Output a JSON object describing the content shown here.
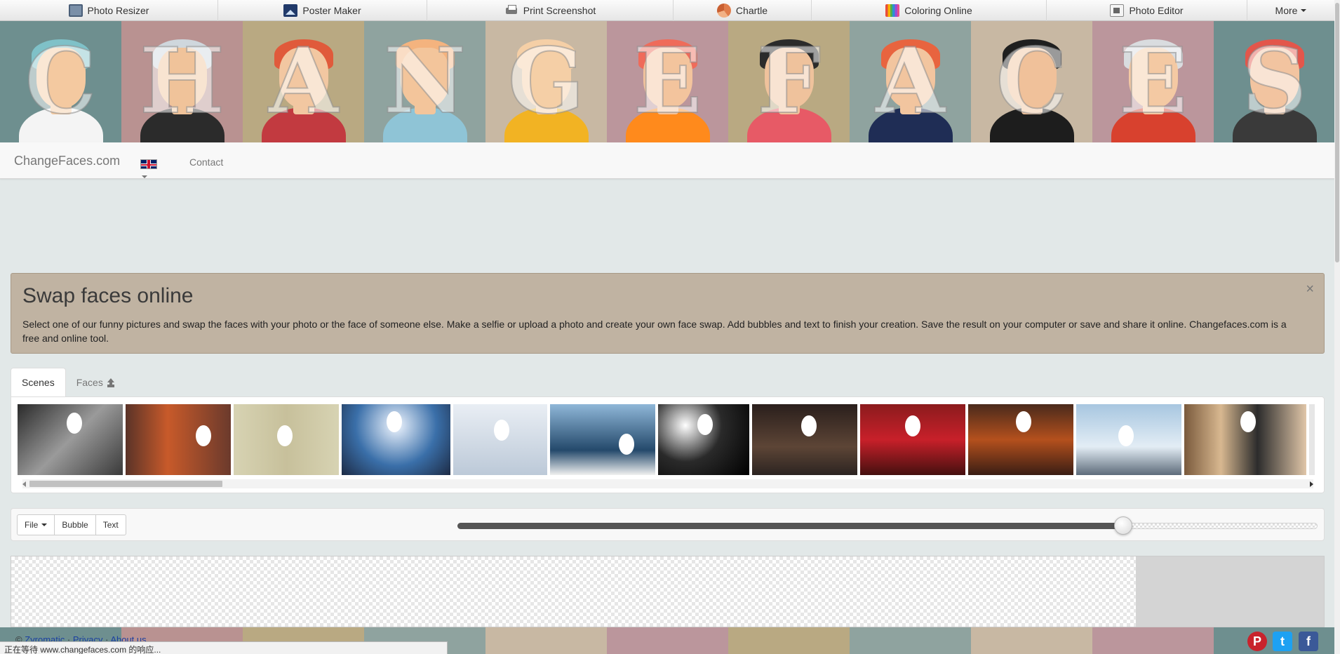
{
  "topbar": {
    "items": [
      {
        "label": "Photo Resizer",
        "icon": "photo-resizer-icon"
      },
      {
        "label": "Poster Maker",
        "icon": "poster-maker-icon"
      },
      {
        "label": "Print Screenshot",
        "icon": "printer-icon"
      },
      {
        "label": "Chartle",
        "icon": "pie-chart-icon"
      },
      {
        "label": "Coloring Online",
        "icon": "color-pencils-icon"
      },
      {
        "label": "Photo Editor",
        "icon": "photo-editor-icon"
      },
      {
        "label": "More"
      }
    ]
  },
  "banner": {
    "letters": [
      "C",
      "H",
      "A",
      "N",
      "G",
      "E",
      "F",
      "A",
      "C",
      "E",
      "S"
    ],
    "panel_colors": [
      "#6e8f8f",
      "#b99291",
      "#b9a982",
      "#8fa39f",
      "#c8b8a3",
      "#bb969c",
      "#b9a982",
      "#8fa39f",
      "#c8b8a3",
      "#bb969c",
      "#6e8f8f"
    ]
  },
  "navbar": {
    "brand": "ChangeFaces.com",
    "language_icon": "uk-flag-icon",
    "contact": "Contact"
  },
  "alert": {
    "title": "Swap faces online",
    "text": "Select one of our funny pictures and swap the faces with your photo or the face of someone else. Make a selfie or upload a photo and create your own face swap. Add bubbles and text to finish your creation. Save the result on your computer or save and share it online. Changefaces.com is a free and online tool.",
    "close": "×"
  },
  "tabs": [
    {
      "label": "Scenes",
      "active": true
    },
    {
      "label": "Faces",
      "icon": "upload-icon"
    }
  ],
  "toolbar": {
    "file": "File",
    "bubble": "Bubble",
    "text": "Text",
    "slider_value": 0.774
  },
  "footer": {
    "copyright": "©",
    "links": [
      "Zyromatic",
      "Privacy",
      "About us"
    ],
    "status": "正在等待 www.changefaces.com 的响应..."
  }
}
